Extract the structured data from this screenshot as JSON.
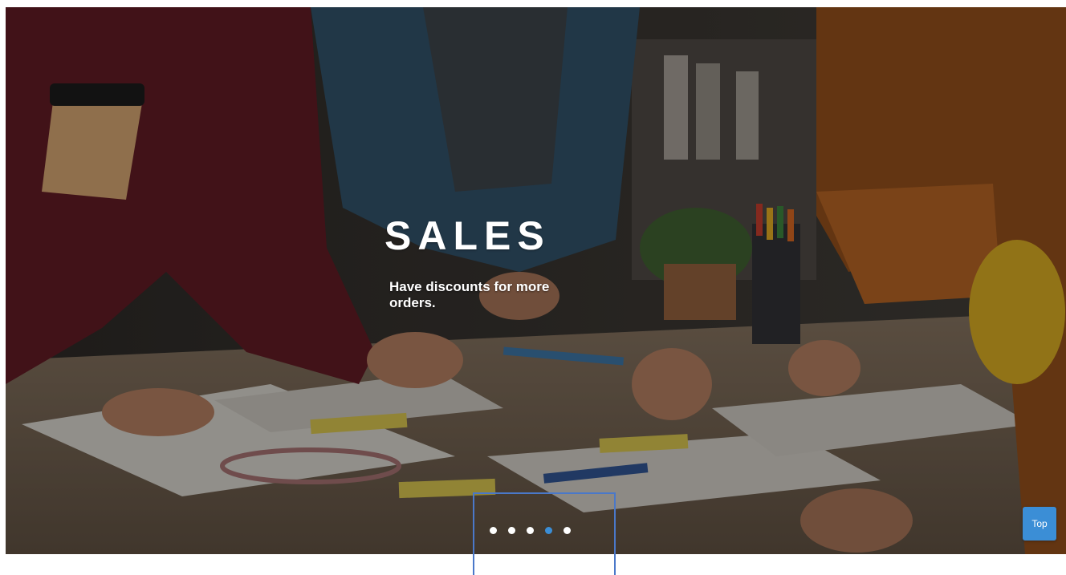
{
  "hero": {
    "title": "SALES",
    "subtitle": "Have discounts for more orders.",
    "image": "office-team-planning-photo"
  },
  "carousel": {
    "total_slides": 5,
    "active_index": 3,
    "dots": [
      {
        "label": ""
      },
      {
        "label": ""
      },
      {
        "label": ""
      },
      {
        "label": ""
      },
      {
        "label": ""
      }
    ],
    "dot_color": "#ffffff",
    "active_dot_color": "#3b8ed6"
  },
  "top_button": {
    "label": "Top",
    "color": "#3b8ed6"
  },
  "focus_outline_color": "#4a78c9"
}
